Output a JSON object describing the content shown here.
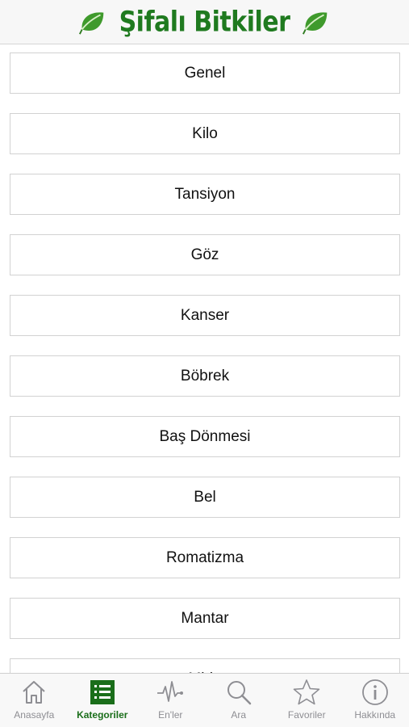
{
  "header": {
    "title": "Şifalı Bitkiler",
    "accent": "#1f7a1f"
  },
  "categories": [
    "Genel",
    "Kilo",
    "Tansiyon",
    "Göz",
    "Kanser",
    "Böbrek",
    "Baş Dönmesi",
    "Bel",
    "Romatizma",
    "Mantar",
    "Mide"
  ],
  "tabbar": {
    "active": "Kategoriler",
    "tabs": [
      {
        "label": "Anasayfa",
        "icon": "home-icon"
      },
      {
        "label": "Kategoriler",
        "icon": "list-icon"
      },
      {
        "label": "En'ler",
        "icon": "pulse-icon"
      },
      {
        "label": "Ara",
        "icon": "search-icon"
      },
      {
        "label": "Favoriler",
        "icon": "star-icon"
      },
      {
        "label": "Hakkında",
        "icon": "info-icon"
      }
    ]
  }
}
